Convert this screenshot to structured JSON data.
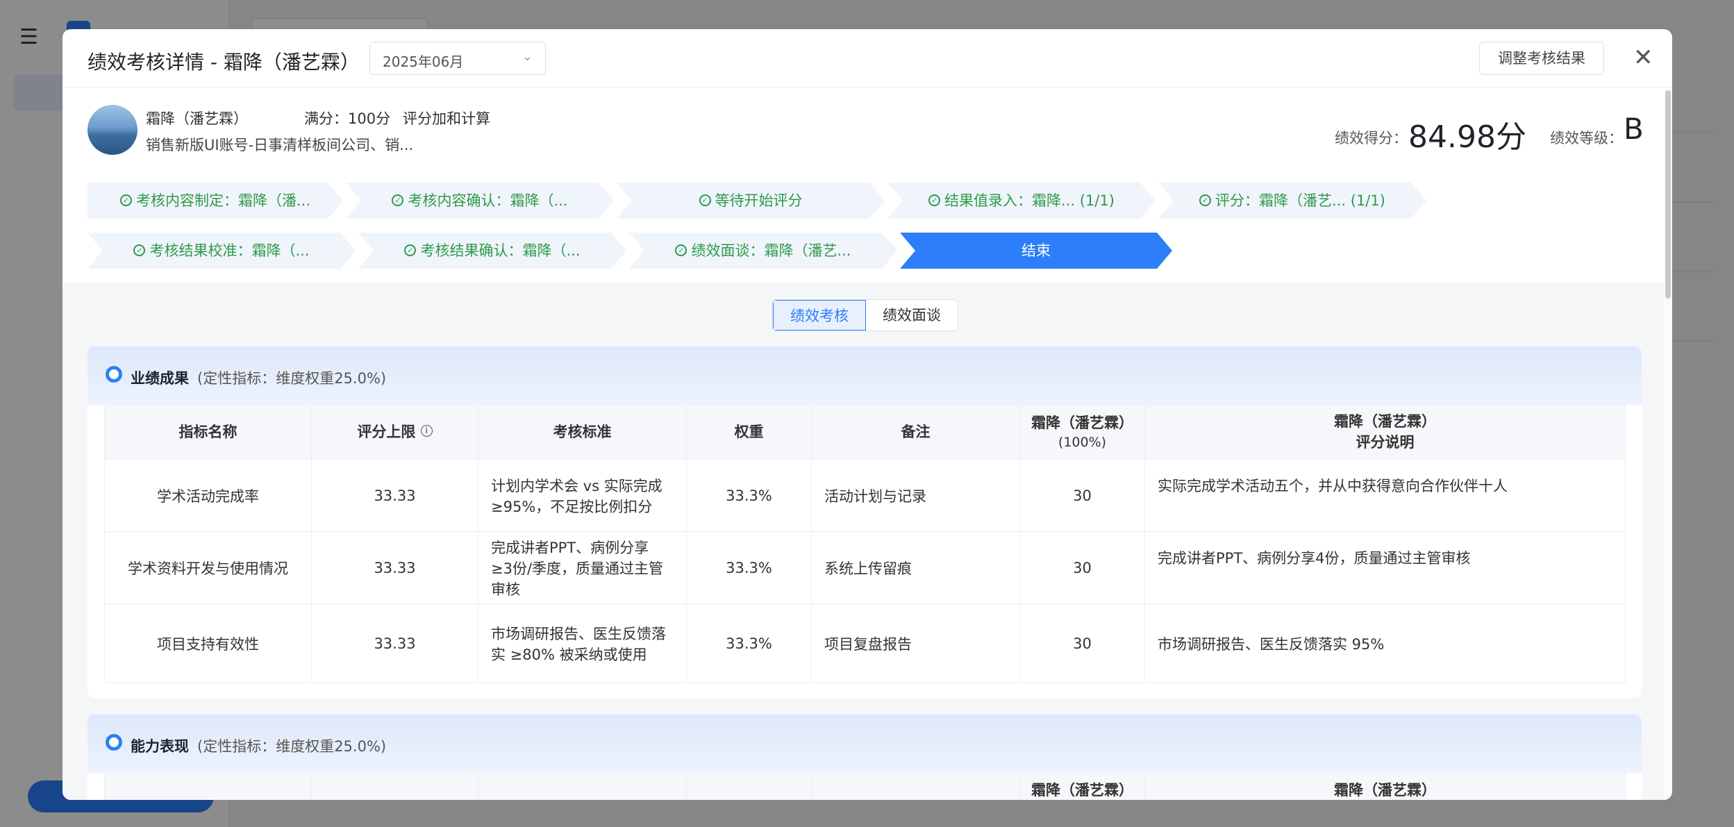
{
  "modal": {
    "title": "绩效考核详情 - 霜降（潘艺霖）",
    "period": "2025年06月",
    "adjust_button": "调整考核结果",
    "close_icon": "close-icon"
  },
  "profile": {
    "name": "霜降（潘艺霖）",
    "full_score": "满分：100分",
    "calc_method": "评分加和计算",
    "org": "销售新版UI账号-日事清样板间公司、销...",
    "score_label": "绩效得分：",
    "score_value": "84.98分",
    "grade_label": "绩效等级：",
    "grade_value": "B"
  },
  "steps": [
    {
      "label": "考核内容制定：霜降（潘...",
      "done": true
    },
    {
      "label": "考核内容确认：霜降（...",
      "done": true
    },
    {
      "label": "等待开始评分",
      "done": true
    },
    {
      "label": "结果值录入：霜降... (1/1)",
      "done": true
    },
    {
      "label": "评分：霜降（潘艺... (1/1)",
      "done": true
    },
    {
      "label": "考核结果校准：霜降（...",
      "done": true
    },
    {
      "label": "考核结果确认：霜降（...",
      "done": true
    },
    {
      "label": "绩效面谈：霜降（潘艺...",
      "done": true
    },
    {
      "label": "结束",
      "done": false
    }
  ],
  "tabs": [
    {
      "label": "绩效考核",
      "active": true
    },
    {
      "label": "绩效面谈",
      "active": false
    }
  ],
  "section1": {
    "title": "业绩成果",
    "subtitle": "(定性指标：维度权重25.0%)",
    "headers": {
      "name": "指标名称",
      "limit": "评分上限",
      "standard": "考核标准",
      "weight": "权重",
      "note": "备注",
      "scorer": "霜降（潘艺霖）",
      "scorer_pct": "(100%)",
      "comment_line1": "霜降（潘艺霖）",
      "comment_line2": "评分说明"
    },
    "rows": [
      {
        "name": "学术活动完成率",
        "limit": "33.33",
        "standard": "计划内学术会 vs 实际完成 ≥95%，不足按比例扣分",
        "weight": "33.3%",
        "note": "活动计划与记录",
        "score": "30",
        "comment": "实际完成学术活动五个，并从中获得意向合作伙伴十人"
      },
      {
        "name": "学术资料开发与使用情况",
        "limit": "33.33",
        "standard": "完成讲者PPT、病例分享 ≥3份/季度，质量通过主管审核",
        "weight": "33.3%",
        "note": "系统上传留痕",
        "score": "30",
        "comment": "完成讲者PPT、病例分享4份，质量通过主管审核"
      },
      {
        "name": "项目支持有效性",
        "limit": "33.33",
        "standard": "市场调研报告、医生反馈落实 ≥80% 被采纳或使用",
        "weight": "33.3%",
        "note": "项目复盘报告",
        "score": "30",
        "comment": "市场调研报告、医生反馈落实 95%"
      }
    ]
  },
  "section2": {
    "title": "能力表现",
    "subtitle": "(定性指标：维度权重25.0%)",
    "headers": {
      "scorer": "霜降（潘艺霖）",
      "comment_line1": "霜降（潘艺霖）"
    }
  }
}
